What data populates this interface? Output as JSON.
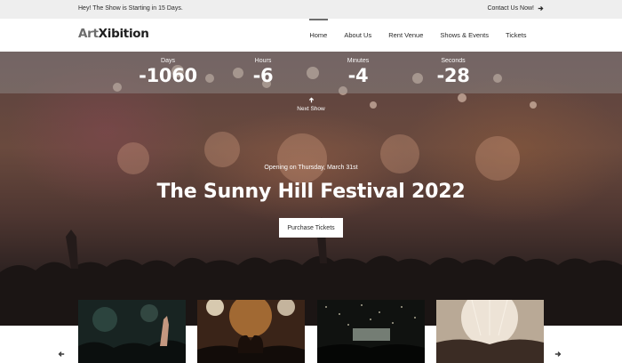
{
  "top_strip": {
    "announcement": "Hey! The Show is Starting in 15 Days.",
    "contact_label": "Contact Us Now!",
    "contact_icon": "arrow-right-icon"
  },
  "header": {
    "logo_part_1": "Art",
    "logo_part_2": "Xibition",
    "nav": [
      {
        "label": "Home",
        "active": true
      },
      {
        "label": "About Us",
        "active": false
      },
      {
        "label": "Rent Venue",
        "active": false
      },
      {
        "label": "Shows & Events",
        "active": false
      },
      {
        "label": "Tickets",
        "active": false
      }
    ]
  },
  "countdown": [
    {
      "label": "Days",
      "value": "-1060"
    },
    {
      "label": "Hours",
      "value": "-6"
    },
    {
      "label": "Minutes",
      "value": "-4"
    },
    {
      "label": "Seconds",
      "value": "-28"
    }
  ],
  "next_show": {
    "label": "Next Show",
    "icon": "arrow-up-icon"
  },
  "hero": {
    "opening": "Opening on Thursday, March 31st",
    "title": "The Sunny Hill Festival 2022",
    "cta": "Purchase Tickets"
  },
  "gallery": {
    "prev_icon": "arrow-left-icon",
    "next_icon": "arrow-right-icon",
    "colors": {
      "accent": "#6d6d6d",
      "top_strip_bg": "#eeeeee"
    }
  }
}
